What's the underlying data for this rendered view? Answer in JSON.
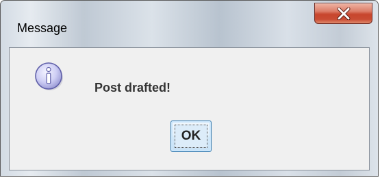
{
  "window": {
    "title": "Message"
  },
  "titlebar": {
    "close_icon": "close-x-icon"
  },
  "dialog": {
    "icon": "information-icon",
    "message": "Post drafted!",
    "ok_label": "OK"
  },
  "colors": {
    "close_button": "#c7452d",
    "ok_border": "#3c7fb1",
    "icon_fill": "#c9c9f3"
  }
}
